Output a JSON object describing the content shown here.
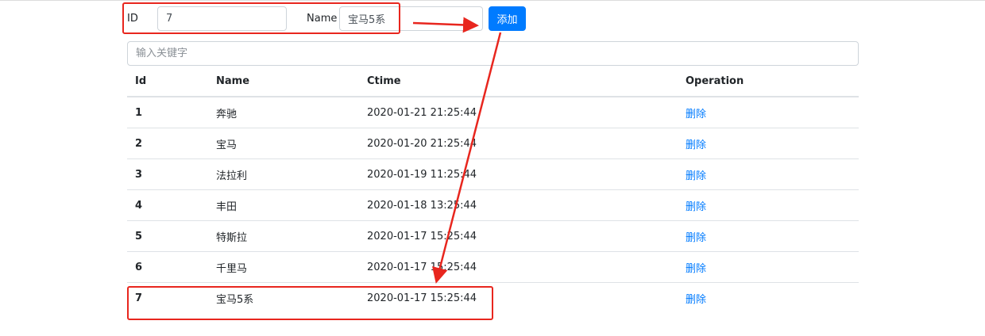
{
  "form": {
    "id_label": "ID",
    "id_value": "7",
    "name_label": "Name",
    "name_value": "宝马5系",
    "add_button_label": "添加"
  },
  "search": {
    "placeholder": "输入关键字",
    "value": ""
  },
  "table": {
    "columns": [
      "Id",
      "Name",
      "Ctime",
      "Operation"
    ],
    "delete_label": "删除",
    "rows": [
      {
        "id": "1",
        "name": "奔驰",
        "ctime": "2020-01-21 21:25:44"
      },
      {
        "id": "2",
        "name": "宝马",
        "ctime": "2020-01-20 21:25:44"
      },
      {
        "id": "3",
        "name": "法拉利",
        "ctime": "2020-01-19 11:25:44"
      },
      {
        "id": "4",
        "name": "丰田",
        "ctime": "2020-01-18 13:25:44"
      },
      {
        "id": "5",
        "name": "特斯拉",
        "ctime": "2020-01-17 15:25:44"
      },
      {
        "id": "6",
        "name": "千里马",
        "ctime": "2020-01-17 15:25:44"
      },
      {
        "id": "7",
        "name": "宝马5系",
        "ctime": "2020-01-17 15:25:44"
      }
    ]
  },
  "annotations": {
    "color": "#e8261e"
  },
  "colors": {
    "primary": "#007bff",
    "border": "#dee2e6"
  }
}
